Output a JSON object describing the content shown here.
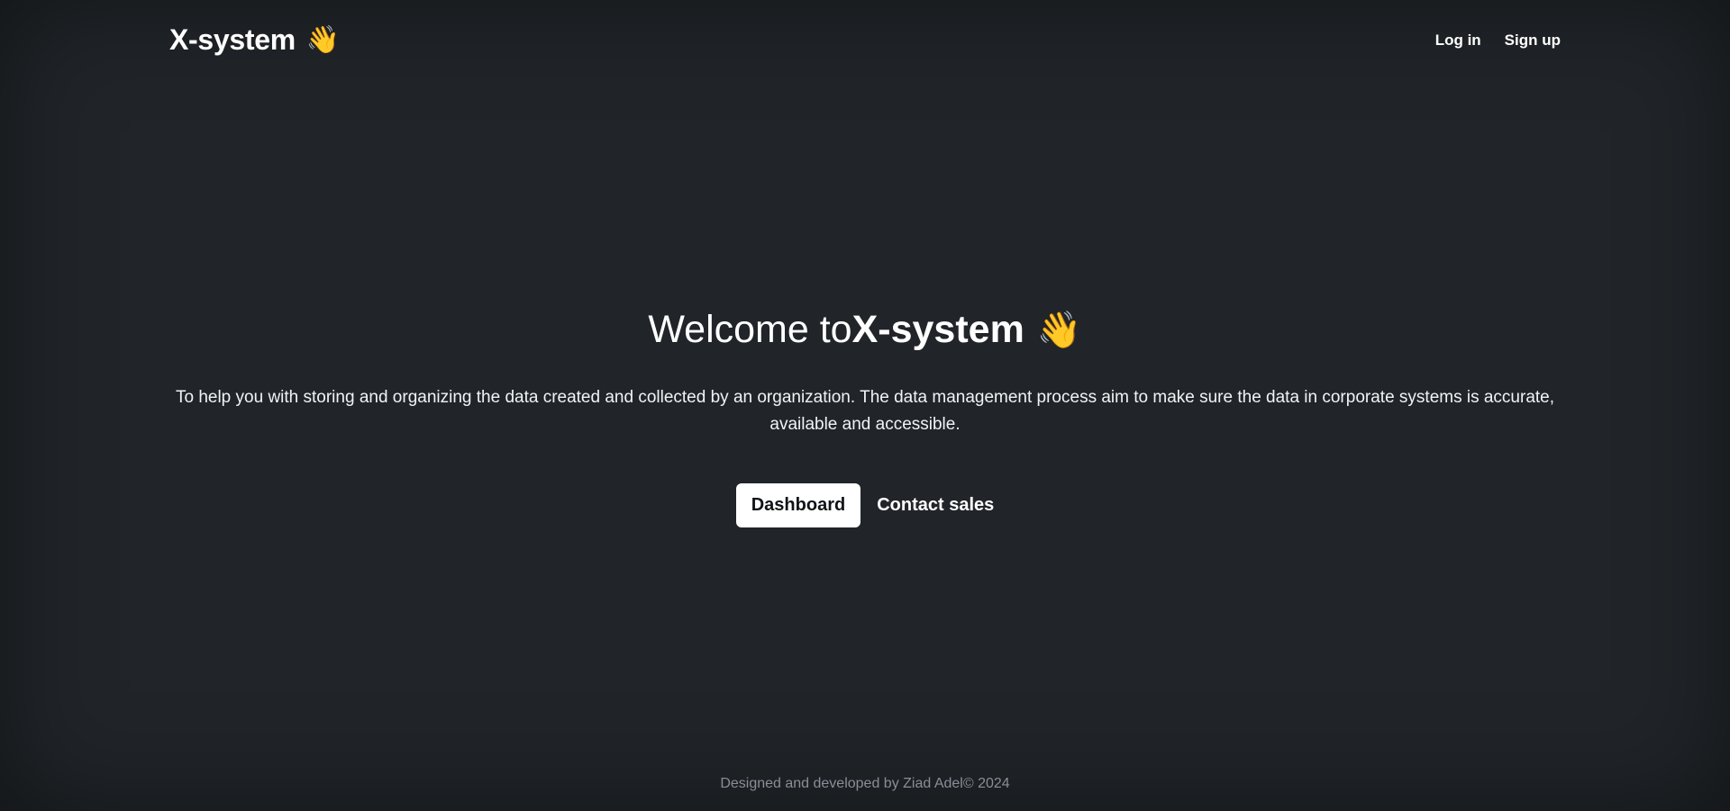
{
  "header": {
    "brand": "X-system",
    "brand_icon": "waving-hand-icon",
    "nav": {
      "login_label": "Log in",
      "signup_label": "Sign up"
    }
  },
  "hero": {
    "title_prefix": "Welcome to",
    "title_name": "X-system",
    "title_icon": "waving-hand-icon",
    "description": "To help you with storing and organizing the data created and collected by an organization. The data management process aim to make sure the data in corporate systems is accurate, available and accessible.",
    "primary_button": "Dashboard",
    "secondary_button": "Contact sales"
  },
  "footer": {
    "text": "Designed and developed by Ziad Adel© 2024"
  },
  "colors": {
    "background": "#212529",
    "text": "#ffffff",
    "footer_text": "#8a8f96",
    "primary_button_bg": "#ffffff"
  }
}
